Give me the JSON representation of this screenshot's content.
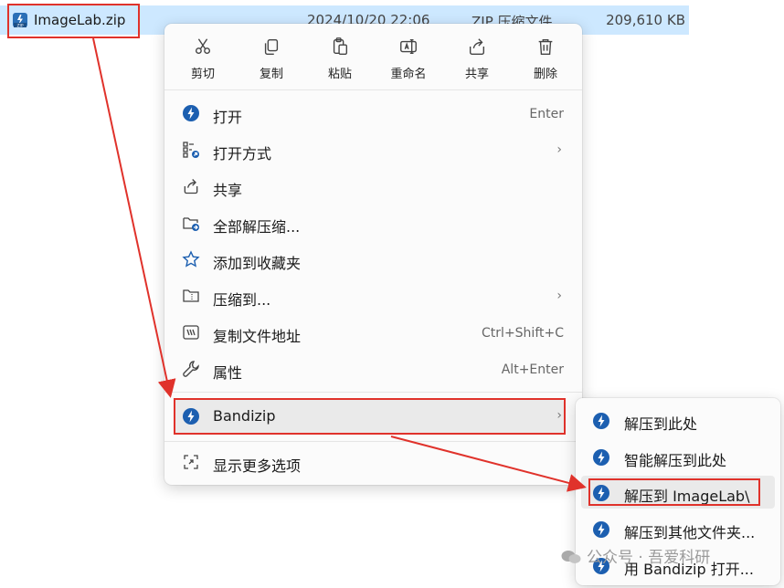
{
  "file": {
    "name": "ImageLab.zip",
    "date": "2024/10/20 22:06",
    "type": "ZIP 压缩文件",
    "size": "209,610 KB"
  },
  "toolbar": [
    {
      "label": "剪切",
      "icon": "cut-icon"
    },
    {
      "label": "复制",
      "icon": "copy-icon"
    },
    {
      "label": "粘贴",
      "icon": "paste-icon"
    },
    {
      "label": "重命名",
      "icon": "rename-icon"
    },
    {
      "label": "共享",
      "icon": "share-icon"
    },
    {
      "label": "删除",
      "icon": "delete-icon"
    }
  ],
  "menu": [
    {
      "label": "打开",
      "shortcut": "Enter",
      "icon": "bandizip-icon"
    },
    {
      "label": "打开方式",
      "submenu": true,
      "icon": "open-with-icon"
    },
    {
      "label": "共享",
      "icon": "share-icon"
    },
    {
      "label": "全部解压缩...",
      "icon": "extract-all-icon"
    },
    {
      "label": "添加到收藏夹",
      "icon": "star-icon"
    },
    {
      "label": "压缩到...",
      "submenu": true,
      "icon": "compress-icon"
    },
    {
      "label": "复制文件地址",
      "shortcut": "Ctrl+Shift+C",
      "icon": "copy-path-icon"
    },
    {
      "label": "属性",
      "shortcut": "Alt+Enter",
      "icon": "wrench-icon"
    }
  ],
  "bandizip": {
    "label": "Bandizip",
    "submenu": true,
    "icon": "bandizip-icon"
  },
  "more": {
    "label": "显示更多选项",
    "icon": "more-options-icon"
  },
  "submenu": [
    {
      "label": "解压到此处"
    },
    {
      "label": "智能解压到此处"
    },
    {
      "label": "解压到 ImageLab\\"
    },
    {
      "label": "解压到其他文件夹..."
    },
    {
      "label": "用 Bandizip 打开..."
    }
  ],
  "chevron": "›",
  "watermark": "公众号 · 吾爱科研",
  "watermark_corner": "公众号 · 吾爱科研",
  "colors": {
    "accent": "#0067c0",
    "highlight_box": "#e0322b",
    "selection": "#cde8ff"
  }
}
